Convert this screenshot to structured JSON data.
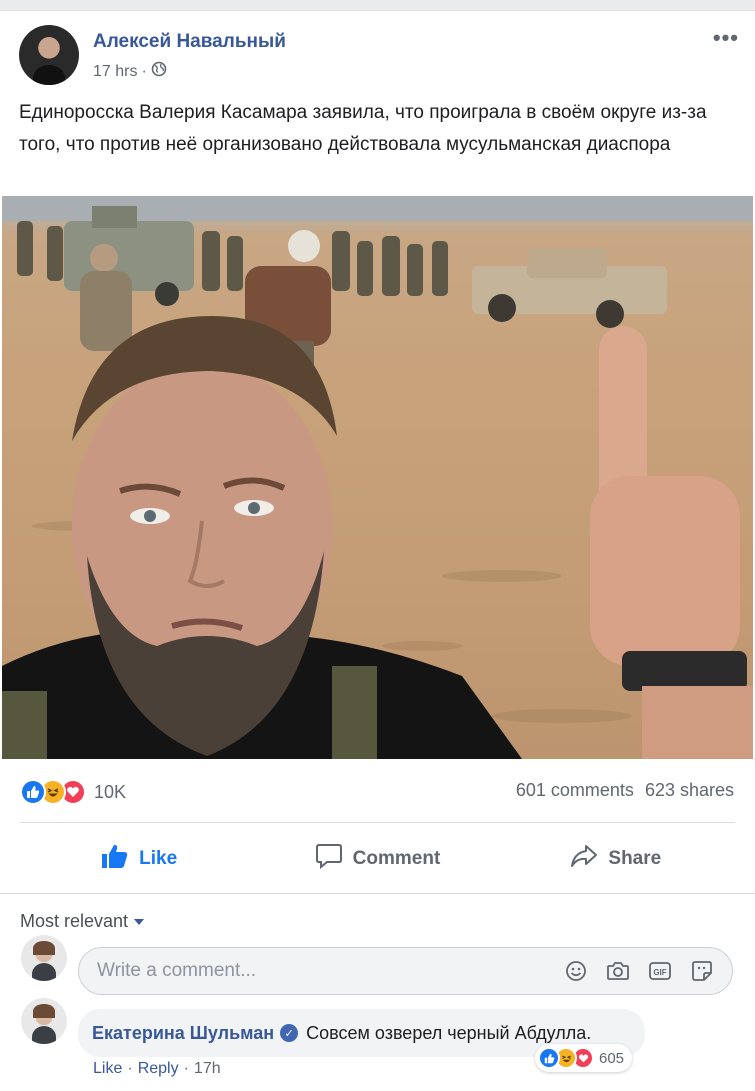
{
  "post": {
    "author": "Алексей Навальный",
    "time": "17 hrs",
    "separator": "·",
    "privacy_icon": "globe-icon",
    "menu_icon": "more-dots-icon",
    "menu_label": "•••",
    "text": "Единоросска Валерия Касамара заявила, что проиграла в своём округе из-за того, что против неё организовано действовала мусульманская диаспора",
    "photo_icon": "desert-selfie-photo"
  },
  "stats": {
    "reactions": [
      "like",
      "haha",
      "love"
    ],
    "reaction_count": "10K",
    "comments": "601 comments",
    "shares": "623 shares"
  },
  "actions": {
    "like": "Like",
    "comment": "Comment",
    "share": "Share"
  },
  "comments_section": {
    "sort_label": "Most relevant",
    "input_placeholder": "Write a comment...",
    "input_icons": [
      "emoji-icon",
      "camera-icon",
      "gif-icon",
      "sticker-icon"
    ],
    "gif_label": "GIF"
  },
  "comment": {
    "author": "Екатерина Шульман",
    "verified": true,
    "text": "Совсем озверел черный Абдулла.",
    "reaction_count": "605",
    "like": "Like",
    "reply": "Reply",
    "time": "17h",
    "separator": "·"
  },
  "colors": {
    "brand_blue": "#385898",
    "like_blue": "#1877f2",
    "haha_yellow": "#f7b125",
    "love_red": "#f33e58"
  }
}
